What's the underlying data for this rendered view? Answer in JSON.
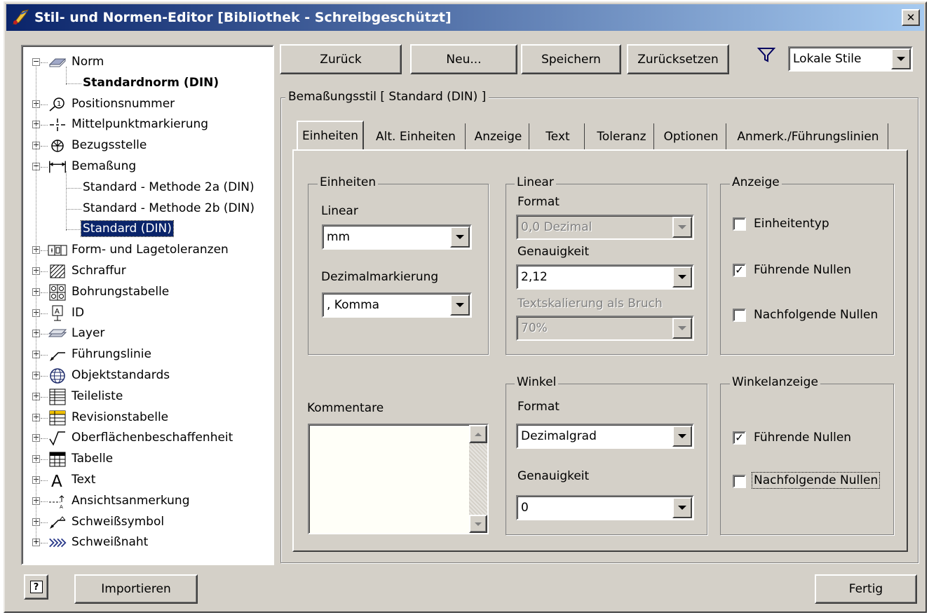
{
  "window": {
    "title": "Stil- und Normen-Editor [Bibliothek - Schreibgeschützt]",
    "close_symbol": "✕"
  },
  "toolbar": {
    "back_label": "Zurück",
    "new_label": "Neu...",
    "save_label": "Speichern",
    "reset_label": "Zurücksetzen",
    "filter_value": "Lokale Stile"
  },
  "tree": {
    "items": [
      {
        "label": "Norm",
        "icon": "norm-icon",
        "expander": "−"
      },
      {
        "label": "Standardnorm (DIN)",
        "bold": true
      },
      {
        "label": "Positionsnummer",
        "icon": "balloon-icon",
        "expander": "+"
      },
      {
        "label": "Mittelpunktmarkierung",
        "icon": "centermark-icon",
        "expander": "+"
      },
      {
        "label": "Bezugsstelle",
        "icon": "datum-icon",
        "expander": "+"
      },
      {
        "label": "Bemaßung",
        "icon": "dimension-icon",
        "expander": "−"
      },
      {
        "label": "Standard - Methode 2a (DIN)"
      },
      {
        "label": "Standard - Methode 2b (DIN)"
      },
      {
        "label": "Standard (DIN)",
        "selected": true
      },
      {
        "label": "Form- und Lagetoleranzen",
        "icon": "fcf-icon",
        "expander": "+"
      },
      {
        "label": "Schraffur",
        "icon": "hatch-icon",
        "expander": "+"
      },
      {
        "label": "Bohrungstabelle",
        "icon": "holetable-icon",
        "expander": "+"
      },
      {
        "label": "ID",
        "icon": "id-icon",
        "expander": "+"
      },
      {
        "label": "Layer",
        "icon": "layer-icon",
        "expander": "+"
      },
      {
        "label": "Führungslinie",
        "icon": "leader-icon",
        "expander": "+"
      },
      {
        "label": "Objektstandards",
        "icon": "globe-icon",
        "expander": "+"
      },
      {
        "label": "Teileliste",
        "icon": "partslist-icon",
        "expander": "+"
      },
      {
        "label": "Revisionstabelle",
        "icon": "revtable-icon",
        "expander": "+"
      },
      {
        "label": "Oberflächenbeschaffenheit",
        "icon": "surface-icon",
        "expander": "+"
      },
      {
        "label": "Tabelle",
        "icon": "table-icon",
        "expander": "+"
      },
      {
        "label": "Text",
        "icon": "text-icon",
        "expander": "+"
      },
      {
        "label": "Ansichtsanmerkung",
        "icon": "viewannot-icon",
        "expander": "+"
      },
      {
        "label": "Schweißsymbol",
        "icon": "weldsymbol-icon",
        "expander": "+"
      },
      {
        "label": "Schweißnaht",
        "icon": "weldbead-icon",
        "expander": "+"
      }
    ]
  },
  "panel": {
    "legend": "Bemaßungsstil [ Standard (DIN) ]",
    "tabs": [
      "Einheiten",
      "Alt. Einheiten",
      "Anzeige",
      "Text",
      "Toleranz",
      "Optionen",
      "Anmerk./Führungslinien"
    ],
    "units_group": {
      "title": "Einheiten",
      "linear_label": "Linear",
      "linear_value": "mm",
      "decimal_label": "Dezimalmarkierung",
      "decimal_value": ", Komma"
    },
    "linear_group": {
      "title": "Linear",
      "format_label": "Format",
      "format_value": "0,0 Dezimal",
      "precision_label": "Genauigkeit",
      "precision_value": "2,12",
      "fraction_label": "Textskalierung als Bruch",
      "fraction_value": "70%"
    },
    "display_group": {
      "title": "Anzeige",
      "unit_type": {
        "label": "Einheitentyp",
        "checked": false
      },
      "leading_zeros": {
        "label": "Führende Nullen",
        "checked": true
      },
      "trailing_zeros": {
        "label": "Nachfolgende Nullen",
        "checked": false
      }
    },
    "comments_label": "Kommentare",
    "angle_group": {
      "title": "Winkel",
      "format_label": "Format",
      "format_value": "Dezimalgrad",
      "precision_label": "Genauigkeit",
      "precision_value": "0"
    },
    "angle_display_group": {
      "title": "Winkelanzeige",
      "leading_zeros": {
        "label": "Führende Nullen",
        "checked": true
      },
      "trailing_zeros": {
        "label": "Nachfolgende Nullen",
        "checked": false
      }
    }
  },
  "footer": {
    "help_label": "?",
    "import_label": "Importieren",
    "done_label": "Fertig"
  }
}
